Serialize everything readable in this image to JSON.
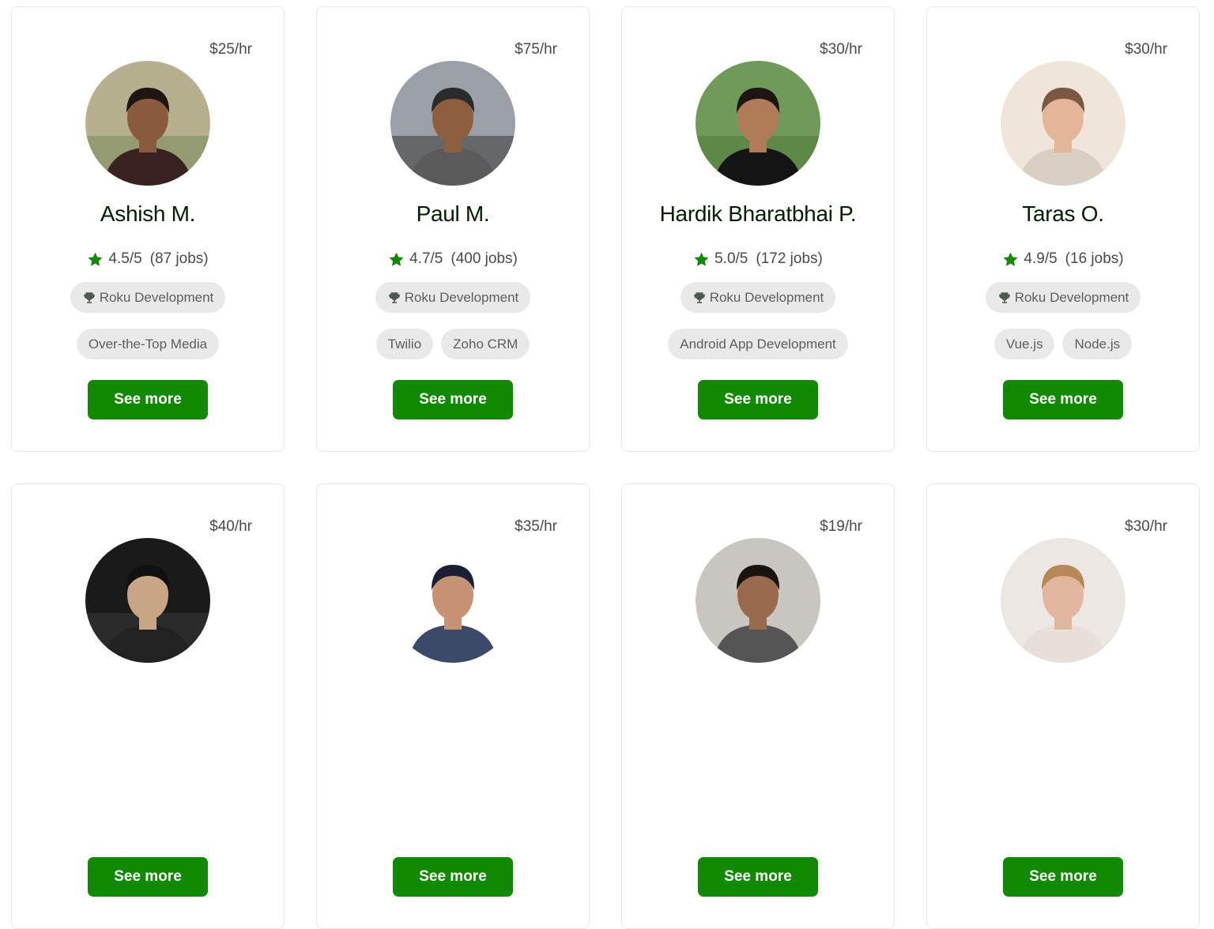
{
  "colors": {
    "accent": "#108a00",
    "pill_bg": "#e9e9e9",
    "card_border": "#e4ebe4",
    "text_dark": "#001e00",
    "text_muted": "#4a4a4a"
  },
  "see_more_label": "See more",
  "freelancers": [
    {
      "rate": "$25/hr",
      "name": "Ashish M.",
      "rating": "4.5/5",
      "jobs": "(87 jobs)",
      "top_skill": "Roku Development",
      "skills": [
        "Over-the-Top Media"
      ],
      "avatar": {
        "bg": "#b7b08f",
        "skin": "#8a5a3c",
        "hair": "#1e1612",
        "shirt": "#3a2220",
        "scene": "#7a8a5a"
      }
    },
    {
      "rate": "$75/hr",
      "name": "Paul M.",
      "rating": "4.7/5",
      "jobs": "(400 jobs)",
      "top_skill": "Roku Development",
      "skills": [
        "Twilio",
        "Zoho CRM"
      ],
      "avatar": {
        "bg": "#9aa0a6",
        "skin": "#8d5f3f",
        "hair": "#2b2b2b",
        "shirt": "#5b5b5b",
        "scene": "#3a3a3a"
      }
    },
    {
      "rate": "$30/hr",
      "name": "Hardik Bharatbhai P.",
      "rating": "5.0/5",
      "jobs": "(172 jobs)",
      "top_skill": "Roku Development",
      "skills": [
        "Android App Development"
      ],
      "avatar": {
        "bg": "#6f9a58",
        "skin": "#b07c58",
        "hair": "#1c1512",
        "shirt": "#141414",
        "scene": "#4f7b3c"
      }
    },
    {
      "rate": "$30/hr",
      "name": "Taras O.",
      "rating": "4.9/5",
      "jobs": "(16 jobs)",
      "top_skill": "Roku Development",
      "skills": [
        "Vue.js",
        "Node.js"
      ],
      "avatar": {
        "bg": "#efe6d9",
        "skin": "#e4b597",
        "hair": "#7a5842",
        "shirt": "#d9cfc2",
        "scene": "#efe6d9"
      }
    },
    {
      "rate": "$40/hr",
      "name": "",
      "rating": "",
      "jobs": "",
      "top_skill": "",
      "skills": [],
      "avatar": {
        "bg": "#1a1a1a",
        "skin": "#c8a585",
        "hair": "#111111",
        "shirt": "#222222",
        "scene": "#3a3a3a"
      }
    },
    {
      "rate": "$35/hr",
      "name": "",
      "rating": "",
      "jobs": "",
      "top_skill": "",
      "skills": [],
      "avatar": {
        "bg": "#ffffff",
        "skin": "#c69274",
        "hair": "#1b1f33",
        "shirt": "#3c4a6a",
        "scene": "#ffffff"
      }
    },
    {
      "rate": "$19/hr",
      "name": "",
      "rating": "",
      "jobs": "",
      "top_skill": "",
      "skills": [],
      "avatar": {
        "bg": "#c9c6c2",
        "skin": "#9a6a4c",
        "hair": "#1a1411",
        "shirt": "#555555",
        "scene": "#c9c6c2"
      }
    },
    {
      "rate": "$30/hr",
      "name": "",
      "rating": "",
      "jobs": "",
      "top_skill": "",
      "skills": [],
      "avatar": {
        "bg": "#ece7e2",
        "skin": "#e0b79c",
        "hair": "#b68856",
        "shirt": "#e8e0d8",
        "scene": "#ece7e2"
      }
    }
  ]
}
